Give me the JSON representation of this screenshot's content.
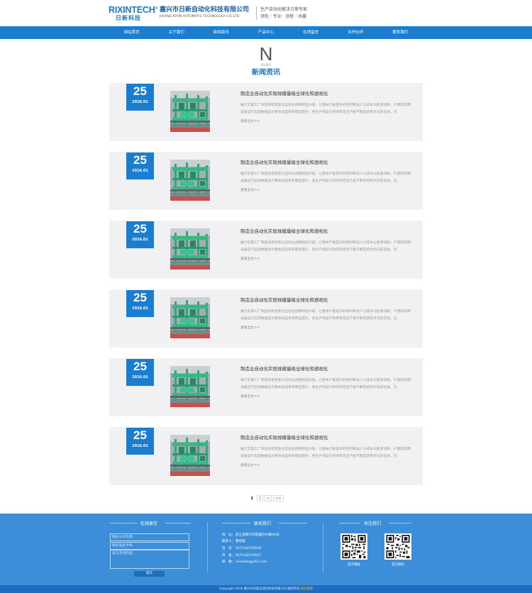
{
  "header": {
    "logo_en": "RIXINTECH",
    "logo_mark": "®",
    "logo_cn": "日新科技",
    "company_cn": "嘉兴市日新自动化科技有限公司",
    "company_en": "JIAXING RIXIN AUTOMATIC TECHNOLOGY CO.,LTD.",
    "slogan_1": "生产自动化解决方案专家",
    "slogan_2": "领先 · 专业 · 创新 · 共赢"
  },
  "nav": {
    "items": [
      {
        "label": "网站首页"
      },
      {
        "label": "关于我们"
      },
      {
        "label": "新闻资讯"
      },
      {
        "label": "产品中心"
      },
      {
        "label": "在线留言"
      },
      {
        "label": "合作伙伴"
      },
      {
        "label": "联系我们"
      }
    ]
  },
  "section": {
    "letter": "N",
    "sub": "NEWS",
    "title": "新闻资讯"
  },
  "news": [
    {
      "day": "25",
      "ym": "2016.01",
      "title": "制造业自动化实现规模量级全球化和透视化",
      "desc_1": "推行实施工厂制造系统智能化自动化战略转型升级，让整体产能提升的同时降低人力成本与能源消耗，产量较前期增长约50%，",
      "desc_2": "设备运行监测数据显示整体良品率有明显提升，各生产线运行效率稳定且产能不断提高稳步向前迈进。在",
      "more": "查看全文>>"
    },
    {
      "day": "25",
      "ym": "2016.01",
      "title": "制造业自动化实现规模量级全球化和透视化",
      "desc_1": "推行实施工厂制造系统智能化自动化战略转型升级，让整体产能提升的同时降低人力成本与能源消耗，产量较前期增长约50%，",
      "desc_2": "设备运行监测数据显示整体良品率有明显提升，各生产线运行效率稳定且产能不断提高稳步向前迈进。在",
      "more": "查看全文>>"
    },
    {
      "day": "25",
      "ym": "2016.01",
      "title": "制造业自动化实现规模量级全球化和透视化",
      "desc_1": "推行实施工厂制造系统智能化自动化战略转型升级，让整体产能提升的同时降低人力成本与能源消耗，产量较前期增长约50%，",
      "desc_2": "设备运行监测数据显示整体良品率有明显提升，各生产线运行效率稳定且产能不断提高稳步向前迈进。在",
      "more": "查看全文>>"
    },
    {
      "day": "25",
      "ym": "2016.01",
      "title": "制造业自动化实现规模量级全球化和透视化",
      "desc_1": "推行实施工厂制造系统智能化自动化战略转型升级，让整体产能提升的同时降低人力成本与能源消耗，产量较前期增长约50%，",
      "desc_2": "设备运行监测数据显示整体良品率有明显提升，各生产线运行效率稳定且产能不断提高稳步向前迈进。在",
      "more": "查看全文>>"
    },
    {
      "day": "25",
      "ym": "2016.01",
      "title": "制造业自动化实现规模量级全球化和透视化",
      "desc_1": "推行实施工厂制造系统智能化自动化战略转型升级，让整体产能提升的同时降低人力成本与能源消耗，产量较前期增长约50%，",
      "desc_2": "设备运行监测数据显示整体良品率有明显提升，各生产线运行效率稳定且产能不断提高稳步向前迈进。在",
      "more": "查看全文>>"
    },
    {
      "day": "25",
      "ym": "2016.01",
      "title": "制造业自动化实现规模量级全球化和透视化",
      "desc_1": "推行实施工厂制造系统智能化自动化战略转型升级，让整体产能提升的同时降低人力成本与能源消耗，产量较前期增长约50%，",
      "desc_2": "设备运行监测数据显示整体良品率有明显提升，各生产线运行效率稳定且产能不断提高稳步向前迈进。在",
      "more": "查看全文>>"
    }
  ],
  "pagination": {
    "pages": [
      "1",
      "2",
      ">",
      ">>"
    ],
    "current": "1"
  },
  "footer": {
    "message": {
      "title": "在线留言",
      "name_placeholder": "姓名/公司名称：",
      "phone_placeholder": "联系电话/手机：",
      "content_placeholder": "留言/反馈内容：",
      "submit": "提交"
    },
    "contact": {
      "title": "联系我们",
      "rows": [
        {
          "label": "地　址：",
          "value": "浙江省嘉兴市南湖区XX路XX号"
        },
        {
          "label": "联系人：",
          "value": "曹经理"
        },
        {
          "label": "电　话：",
          "value": "0573-82535636"
        },
        {
          "label": "传　真：",
          "value": "0573-82574047"
        },
        {
          "label": "邮　箱：",
          "value": "rixinauto@163.com"
        }
      ]
    },
    "follow": {
      "title": "关注我们",
      "qr_1": "官方网站",
      "qr_2": "官方微信"
    },
    "copyright": "Copyright 2016 嘉兴市日新自动化科技有限公司 版权所有",
    "copyright_link": "网站管理"
  },
  "colors": {
    "primary": "#1a7dd0",
    "footer_bg": "#3b8ed7",
    "copyright_bg": "#1d6cbf",
    "card_bg": "#f1f1f3"
  }
}
